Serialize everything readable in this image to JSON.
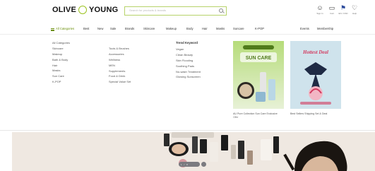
{
  "header": {
    "logo_left": "OLIVE",
    "logo_right": "YOUNG",
    "search_placeholder": "Search for products & brands",
    "utilities": [
      {
        "label": "Sign In",
        "icon": "user-icon"
      },
      {
        "label": "Cart",
        "icon": "bag-icon"
      },
      {
        "label": "EN / USD",
        "icon": "flag-icon"
      },
      {
        "label": "Help",
        "icon": "help-icon"
      }
    ]
  },
  "categories": {
    "all": "All Categories",
    "items": [
      "Best",
      "New",
      "Sale",
      "Brands",
      "Skincare",
      "Makeup",
      "Body",
      "Hair",
      "Masks",
      "Suncare",
      "K-POP"
    ],
    "right": [
      "Events",
      "Membership"
    ]
  },
  "menu": {
    "col1": {
      "items": [
        "All Categories",
        "Skincare",
        "Makeup",
        "Bath & Body",
        "Hair",
        "Masks",
        "Sun Care",
        "K-POP"
      ]
    },
    "col2": {
      "items": [
        "Tools & Brushes",
        "Accessories",
        "Wellness",
        "MEN",
        "Supplements",
        "Food & Drink",
        "Special Value Set"
      ]
    },
    "col3": {
      "heading": "Trend Keyword",
      "items": [
        "Vegan",
        "Clean Beauty",
        "Skin Flooding",
        "Soothing Pads",
        "No-wash Treatment",
        "Glowing Sunscreen"
      ]
    },
    "promos": [
      {
        "caption": "AU Pure Collection Sun Care Exclusive",
        "sub": "Offer",
        "badge": "SUN CARE"
      },
      {
        "caption": "Best Sellers Shipping Set & Deal",
        "sub": "",
        "badge": "Hottest Deal"
      }
    ]
  },
  "hero": {
    "pager_label": "1 / 8"
  },
  "colors": {
    "brand_green": "#9bc31f",
    "promo1_bg": "#a8d26a",
    "promo2_bg": "#cfe3ec",
    "hero_bg": "#efe8e1"
  }
}
